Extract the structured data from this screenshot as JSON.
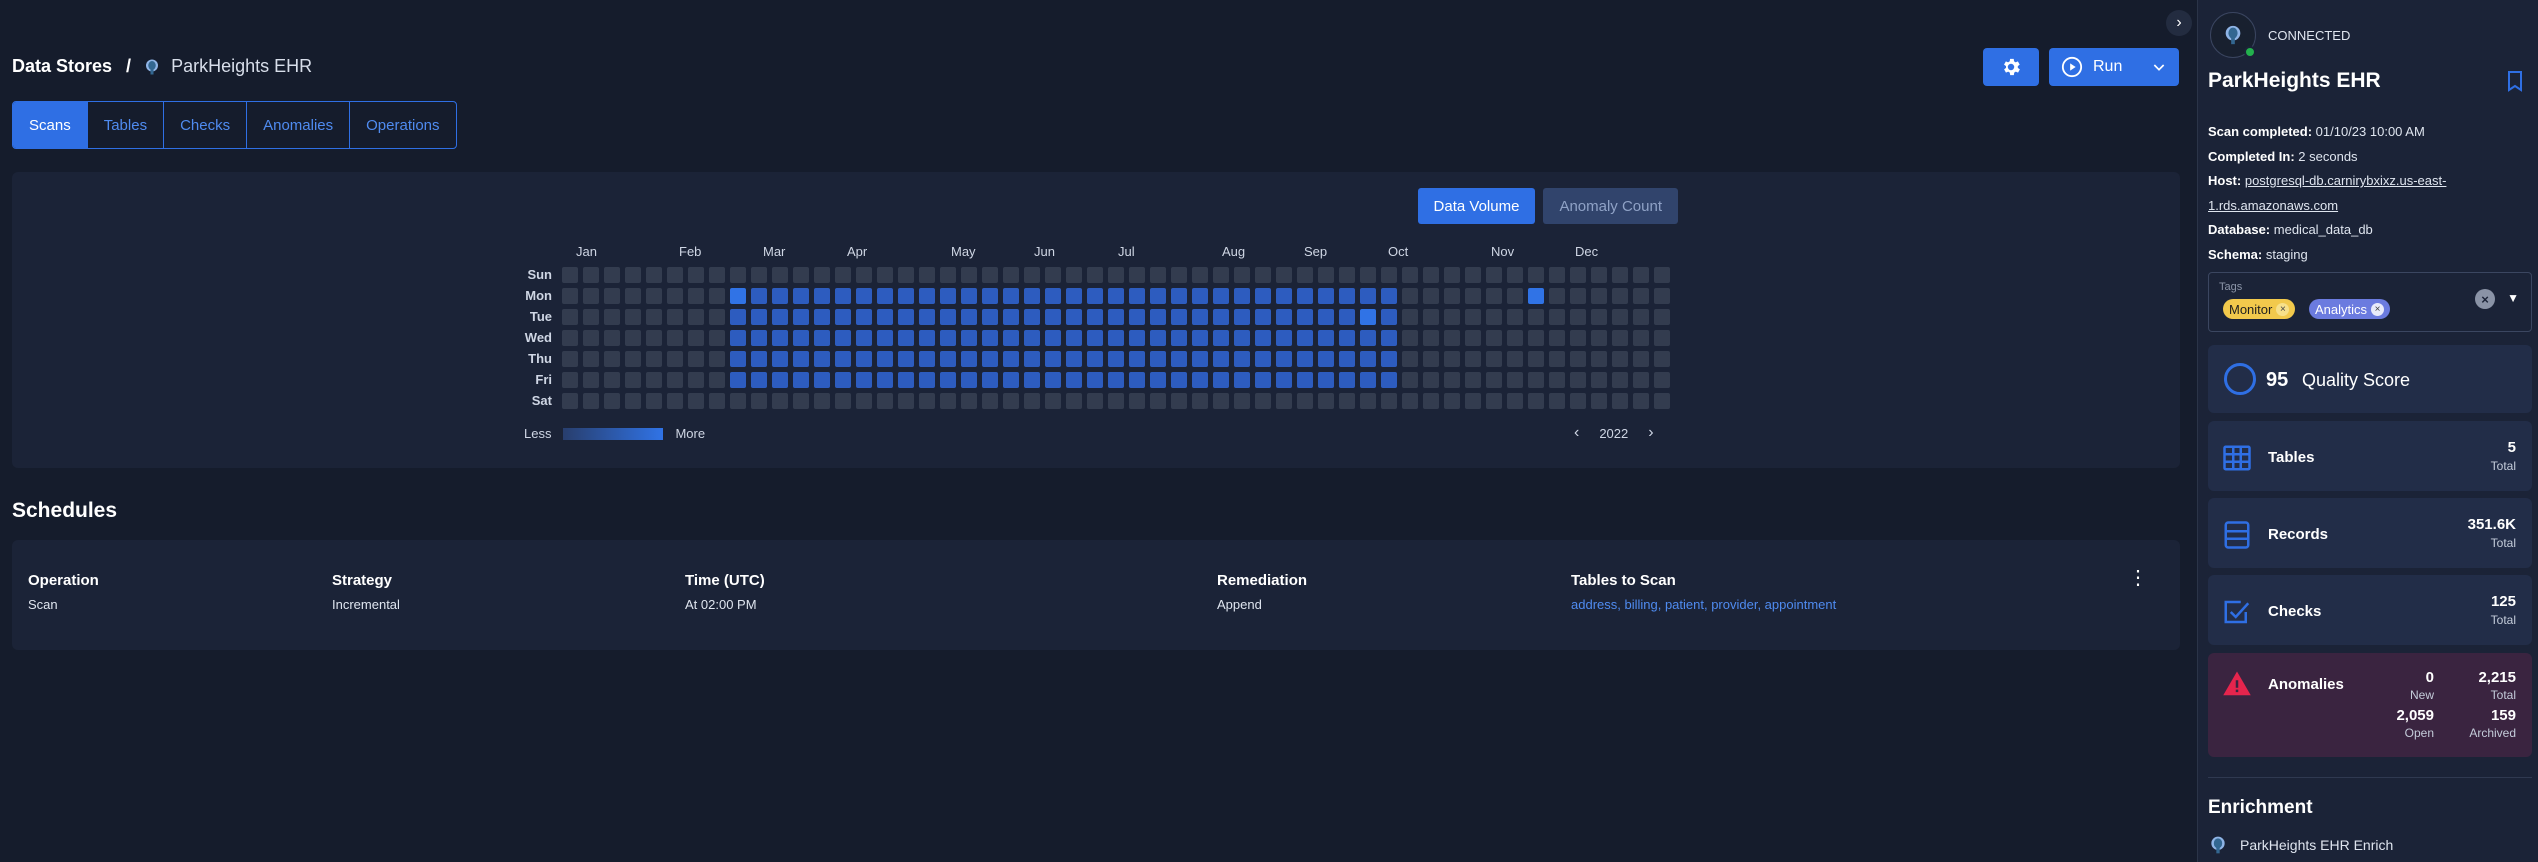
{
  "breadcrumb": {
    "root": "Data Stores",
    "separator": "/",
    "current": "ParkHeights EHR"
  },
  "actions": {
    "run_label": "Run"
  },
  "tabs": [
    "Scans",
    "Tables",
    "Checks",
    "Anomalies",
    "Operations"
  ],
  "active_tab": "Scans",
  "activity": {
    "toggles": {
      "data_volume": "Data Volume",
      "anomaly_count": "Anomaly Count"
    },
    "active_toggle": "Data Volume",
    "months": [
      "Jan",
      "Feb",
      "Mar",
      "Apr",
      "May",
      "Jun",
      "Jul",
      "Aug",
      "Sep",
      "Oct",
      "Nov",
      "Dec"
    ],
    "days": [
      "Sun",
      "Mon",
      "Tue",
      "Wed",
      "Thu",
      "Fri",
      "Sat"
    ],
    "legend": {
      "less": "Less",
      "more": "More"
    },
    "year": "2022",
    "colors": {
      "empty": "#333c4f",
      "low": "#283e6d",
      "mid": "#2d5cbf",
      "high": "#3073e6"
    }
  },
  "schedules": {
    "title": "Schedules",
    "headers": {
      "operation": "Operation",
      "strategy": "Strategy",
      "time": "Time (UTC)",
      "remediation": "Remediation",
      "tables": "Tables to Scan"
    },
    "row": {
      "operation": "Scan",
      "strategy": "Incremental",
      "time": "At 02:00 PM",
      "remediation": "Append",
      "tables": "address, billing, patient, provider, appointment"
    }
  },
  "panel": {
    "status": "CONNECTED",
    "title": "ParkHeights EHR",
    "meta": {
      "scan_completed_label": "Scan completed:",
      "scan_completed": "01/10/23 10:00 AM",
      "completed_in_label": "Completed In:",
      "completed_in": "2 seconds",
      "host_label": "Host:",
      "host": "postgresql-db.carnirybxixz.us-east-1.rds.amazonaws.com",
      "database_label": "Database:",
      "database": "medical_data_db",
      "schema_label": "Schema:",
      "schema": "staging"
    },
    "tags_label": "Tags",
    "tags": [
      "Monitor",
      "Analytics"
    ],
    "quality_score": {
      "value": "95",
      "label": "Quality Score"
    },
    "tables": {
      "label": "Tables",
      "value": "5",
      "sub": "Total"
    },
    "records": {
      "label": "Records",
      "value": "351.6K",
      "sub": "Total"
    },
    "checks": {
      "label": "Checks",
      "value": "125",
      "sub": "Total"
    },
    "anomalies": {
      "label": "Anomalies",
      "new": "0",
      "new_label": "New",
      "total": "2,215",
      "total_label": "Total",
      "open": "2,059",
      "open_label": "Open",
      "archived": "159",
      "archived_label": "Archived"
    },
    "enrichment": {
      "title": "Enrichment",
      "item": "ParkHeights EHR Enrich"
    },
    "colors": {
      "accent": "#2f6fe4",
      "connected": "#23b14d",
      "danger": "#e5254d"
    }
  }
}
